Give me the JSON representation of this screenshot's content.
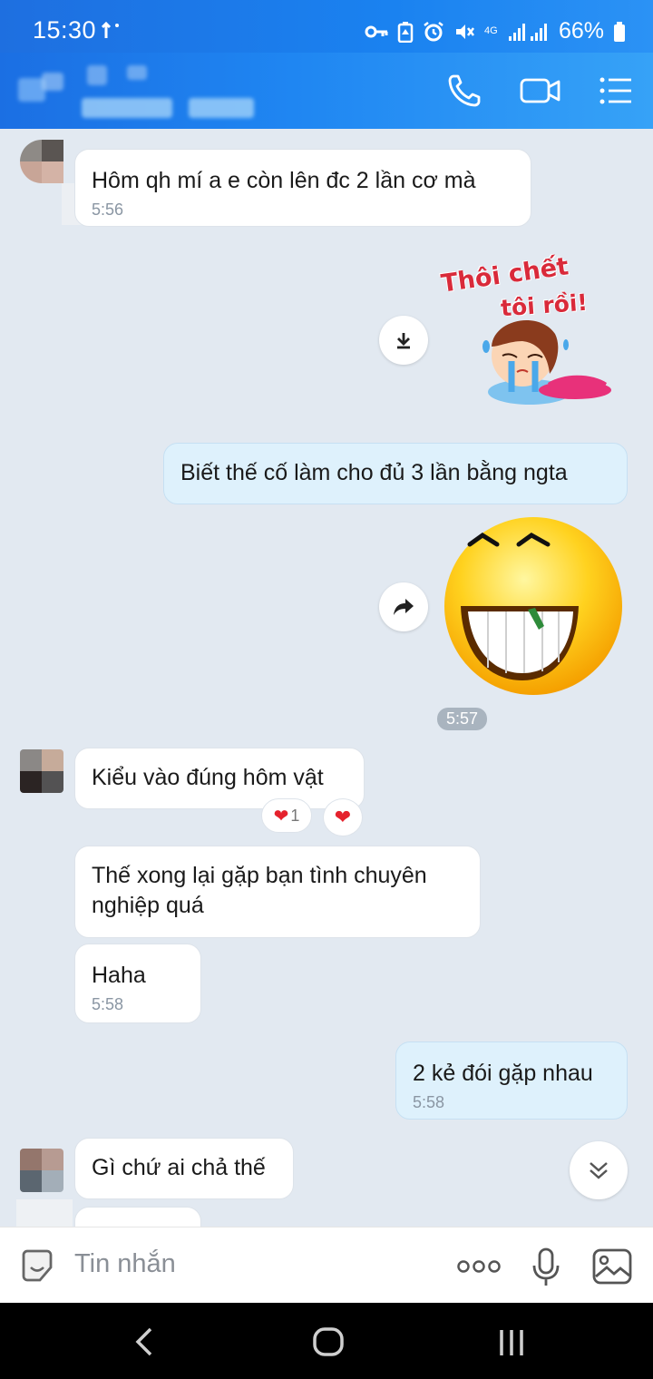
{
  "status_bar": {
    "time": "15:30",
    "network": "4G",
    "battery": "66%"
  },
  "header": {
    "icons": [
      "phone-icon",
      "video-call-icon",
      "menu-list-icon"
    ]
  },
  "messages": {
    "m1": {
      "text": "Hôm qh mí a e còn lên đc 2 lần cơ mà",
      "time": "5:56"
    },
    "sticker1": {
      "text_line1": "Thôi chết",
      "text_line2": "tôi rồi!"
    },
    "m2": {
      "text": "Biết thế cố làm cho đủ 3 lần bằng ngta"
    },
    "emoji_time": "5:57",
    "m3": {
      "text": "Kiểu vào đúng hôm vật",
      "reaction_count": "1"
    },
    "m4": {
      "text_line1": "Thế xong lại gặp bạn tình chuyên",
      "text_line2": "nghiệp quá"
    },
    "m5": {
      "text": "Haha",
      "time": "5:58"
    },
    "m6": {
      "text": "2 kẻ đói gặp nhau",
      "time": "5:58"
    },
    "m7": {
      "text": "Gì chứ ai chả thế"
    }
  },
  "input": {
    "placeholder": "Tin nhắn"
  },
  "colors": {
    "accent": "#1a82f0",
    "outgoing_bubble": "#def1fc",
    "chat_background": "#e2e9f1"
  }
}
